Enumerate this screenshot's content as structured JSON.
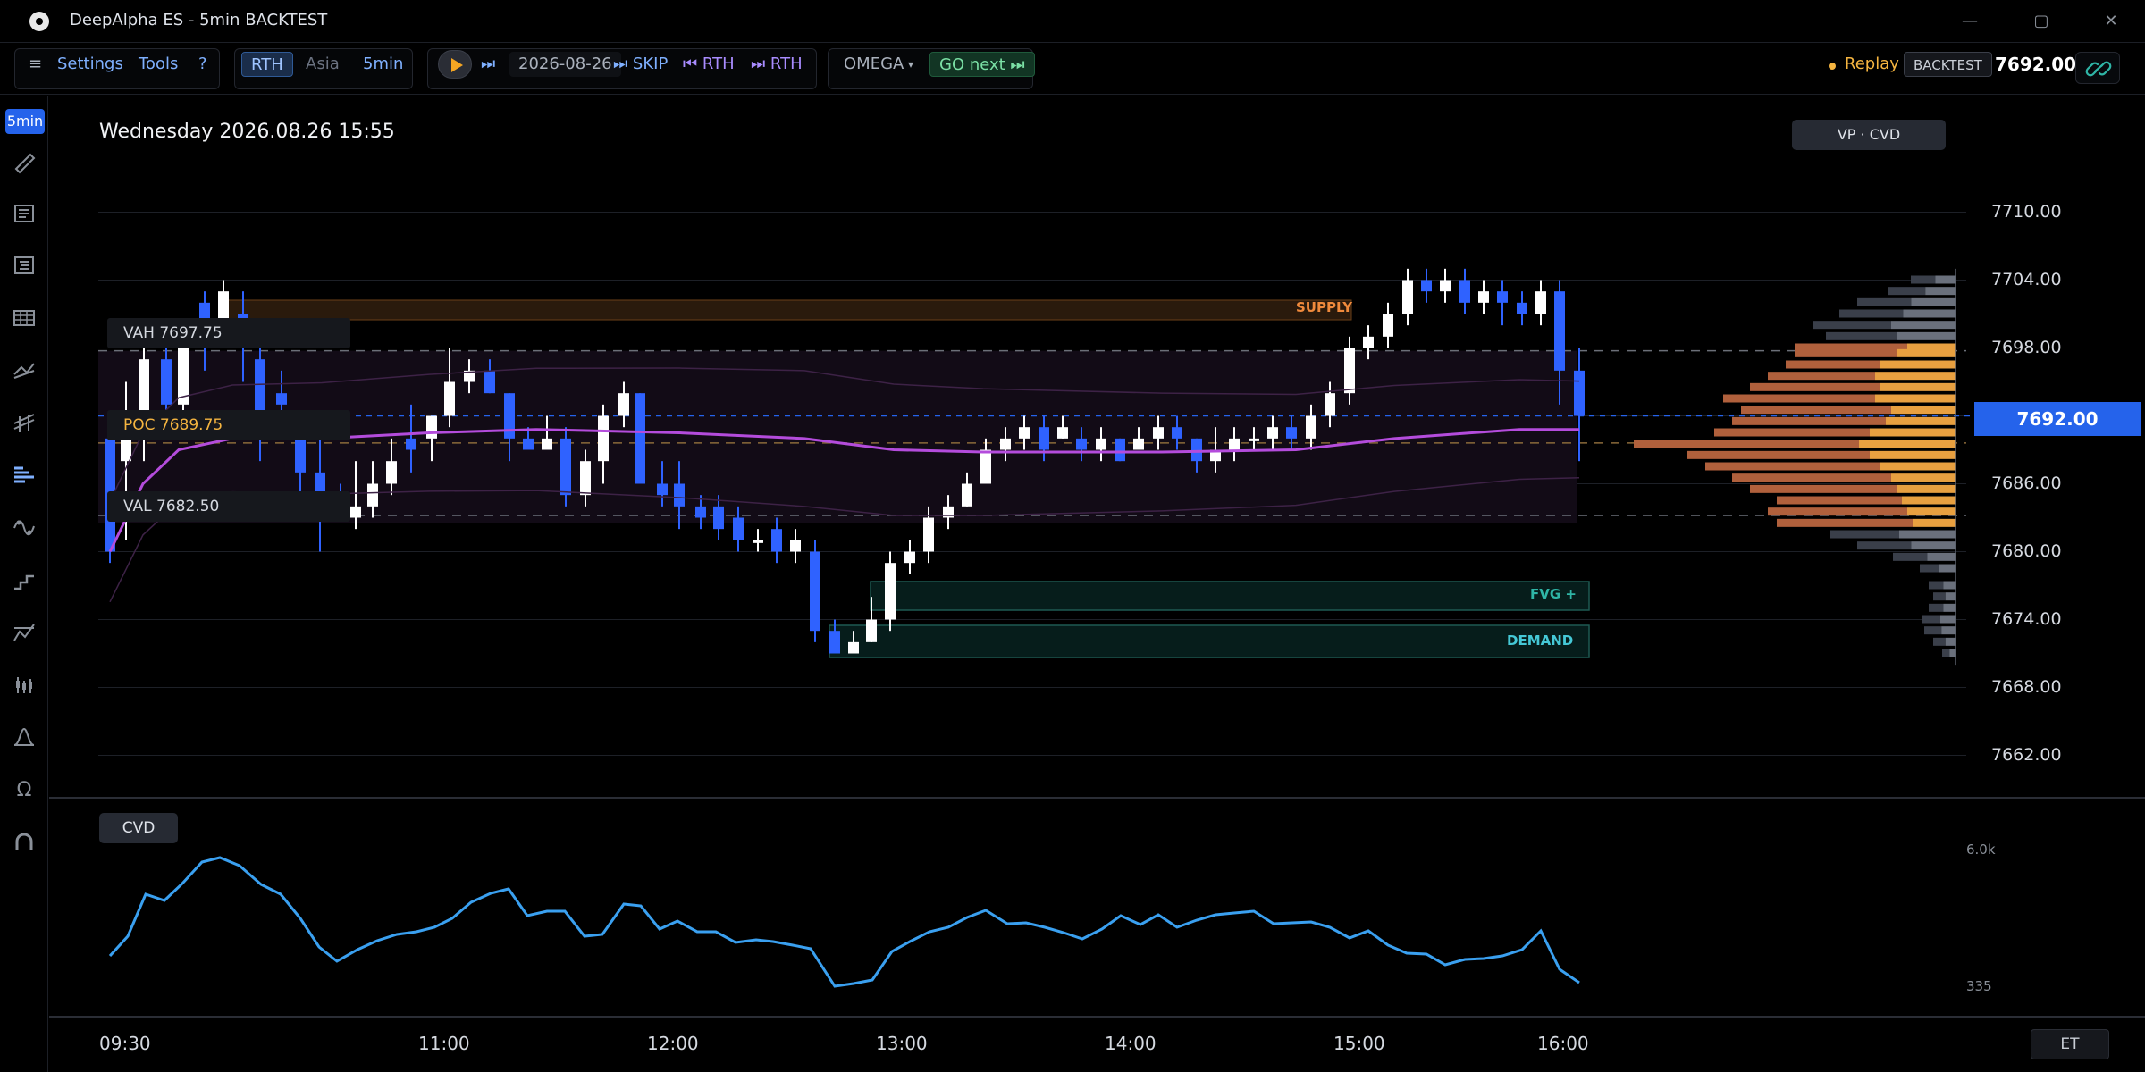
{
  "window": {
    "title": "DeepAlpha ES - 5min BACKTEST",
    "minimize_label": "—",
    "maximize_label": "▢",
    "close_label": "✕"
  },
  "toolbar": {
    "menu_icon": "≡",
    "settings_label": "Settings",
    "tools_label": "Tools",
    "help_label": "?",
    "session_rth": "RTH",
    "session_asia": "Asia",
    "timeframe": "5min",
    "step_label": "⏭",
    "date_value": "2026-08-26",
    "skip_label": "⏭ SKIP",
    "prev_rth_label": "⏮ RTH",
    "next_rth_label": "⏭ RTH",
    "strategy_label": "OMEGA",
    "strategy_caret": "▾",
    "go_next_label": "GO next ⏭",
    "replay_label": "Replay",
    "mode_badge": "BACKTEST",
    "last_price": "7692.00"
  },
  "sidebar": {
    "timeframe_badge": "5min",
    "icons": [
      "ruler-icon",
      "text-lines-icon",
      "bracket-list-icon",
      "table-grid-icon",
      "trend-lines-icon",
      "channel-lines-icon",
      "volume-profile-icon",
      "swing-points-icon",
      "step-chart-icon",
      "zigzag-icon",
      "candles-icon",
      "bell-curve-icon",
      "omega-icon",
      "magnet-icon"
    ]
  },
  "chart": {
    "headline": "Wednesday 2026.08.26 15:55",
    "overlay_button": "VP · CVD",
    "price_tag": "7692.00",
    "y_ticks": [
      "7710.00",
      "7704.00",
      "7698.00",
      "7686.00",
      "7680.00",
      "7674.00",
      "7668.00",
      "7662.00"
    ],
    "levels": {
      "vah": "VAH 7697.75",
      "poc": "POC 7689.75",
      "val": "VAL 7682.50"
    },
    "zones": {
      "supply": "SUPPLY",
      "fvg": "FVG +",
      "demand": "DEMAND"
    },
    "colors": {
      "up": "#ffffff",
      "down": "#2f62ff",
      "vwap": "#b44cdc",
      "supply": "#f08a3c",
      "demand": "#2fb5a6",
      "accent": "#2563eb"
    }
  },
  "cvd": {
    "label": "CVD",
    "max_label": "6.0k",
    "min_label": "335",
    "line_color": "#3aa0f0"
  },
  "x_axis": {
    "labels": [
      "09:30",
      "11:00",
      "12:00",
      "13:00",
      "14:00",
      "15:00",
      "16:00"
    ],
    "timezone": "ET"
  }
}
